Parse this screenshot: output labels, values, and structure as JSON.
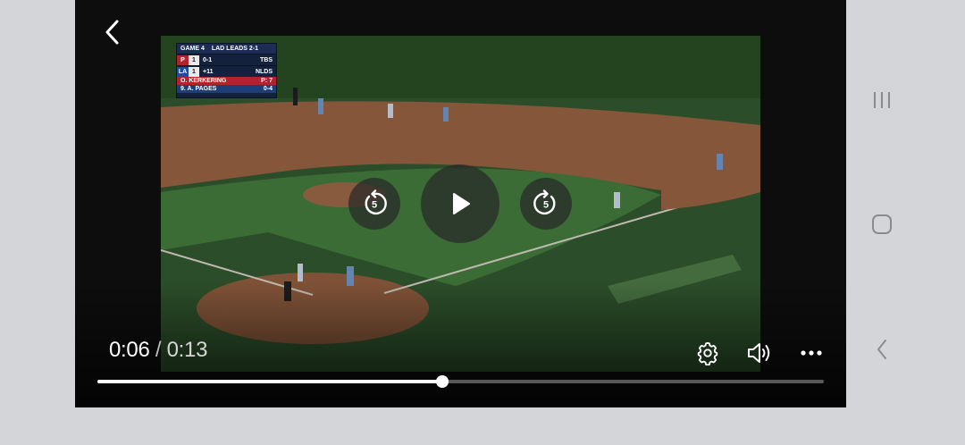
{
  "player": {
    "current_time": "0:06",
    "separator": " / ",
    "duration": "0:13",
    "progress_fraction": 0.475,
    "rewind_seconds": "5",
    "forward_seconds": "5"
  },
  "scorebug": {
    "game": "GAME 4",
    "series": "LAD LEADS 2-1",
    "team1_logo": "P",
    "team1_score": "1",
    "count": "0-1",
    "team2_logo": "LA",
    "team2_score": "1",
    "extra": "+11",
    "network": "TBS",
    "round": "NLDS",
    "pitcher": "O. KERKERING",
    "pitch_count": "P: 7",
    "batter": "9. A. PAGES",
    "batter_stats": "0-4"
  },
  "icons": {
    "back": "chevron-left-icon",
    "rewind": "rewind-5-icon",
    "play": "play-icon",
    "forward": "forward-5-icon",
    "settings": "gear-icon",
    "volume": "speaker-icon",
    "more": "more-horizontal-icon",
    "recents": "recents-icon",
    "home": "home-icon",
    "nav_back": "nav-back-icon"
  },
  "colors": {
    "player_bg": "#0d0d0d",
    "progress_played": "#ffffff",
    "progress_remaining": "#5a5a5a",
    "system_bg": "#d4d5d9"
  }
}
